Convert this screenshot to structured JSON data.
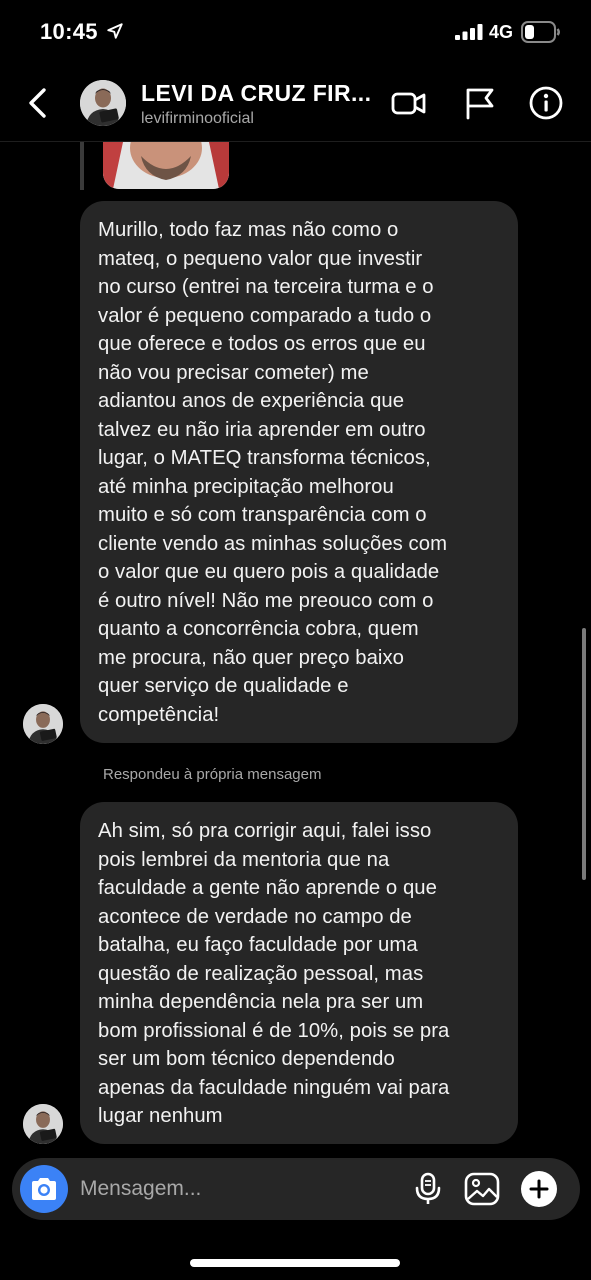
{
  "status_bar": {
    "time": "10:45",
    "network": "4G"
  },
  "header": {
    "title": "LEVI DA CRUZ FIR...",
    "username": "levifirminooficial"
  },
  "messages": [
    {
      "lines": [
        "Murillo, todo faz mas não como o",
        "mateq, o pequeno valor que investir",
        "no curso (entrei na terceira turma e o",
        "valor é pequeno comparado a tudo o",
        "que oferece e todos os erros que eu",
        "não vou precisar cometer) me",
        "adiantou anos de experiência que",
        "talvez eu não iria aprender em outro",
        "lugar, o MATEQ transforma técnicos,",
        "até minha precipitação melhorou",
        "muito e só com transparência com o",
        "cliente vendo as minhas soluções com",
        "o valor que eu quero pois a qualidade",
        "é outro nível! Não me preouco com o",
        "quanto a concorrência cobra, quem",
        "me procura, não quer preço baixo",
        "quer serviço de qualidade e",
        "competência!"
      ]
    },
    {
      "lines": [
        "Ah sim, só pra corrigir aqui, falei isso",
        "pois lembrei da mentoria que na",
        "faculdade a gente não aprende o que",
        "acontece de verdade no campo de",
        "batalha, eu faço faculdade por uma",
        "questão de realização pessoal, mas",
        "minha dependência nela pra ser um",
        "bom profissional é de 10%, pois se pra",
        "ser um bom técnico dependendo",
        "apenas da faculdade ninguém vai para",
        "lugar nenhum"
      ]
    }
  ],
  "reply_note": "Respondeu à própria mensagem",
  "composer": {
    "placeholder": "Mensagem..."
  },
  "colors": {
    "accent": "#3b82f6",
    "bubble": "#262626",
    "background": "#000000",
    "muted_text": "#a8a8a8"
  },
  "icons": [
    "location-arrow-icon",
    "signal-icon",
    "battery-icon",
    "back-arrow-icon",
    "video-call-icon",
    "flag-icon",
    "info-icon",
    "camera-icon",
    "microphone-icon",
    "gallery-icon",
    "plus-icon"
  ]
}
